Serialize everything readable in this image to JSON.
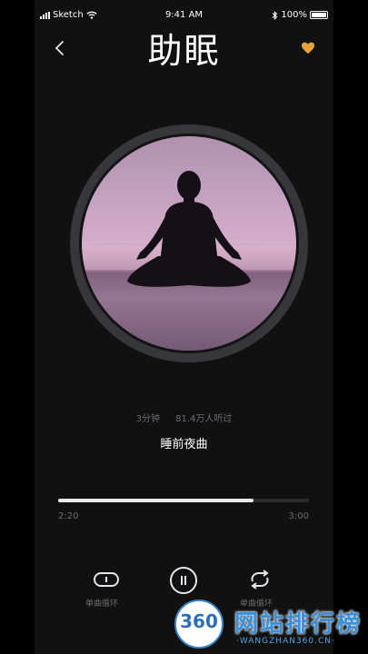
{
  "status_bar": {
    "carrier": "Sketch",
    "time": "9:41 AM",
    "battery": "100%"
  },
  "header": {
    "title": "助眠"
  },
  "track": {
    "duration_label": "3分钟",
    "listens": "81.4万人听过",
    "name": "睡前夜曲"
  },
  "player": {
    "current_time": "2:20",
    "total_time": "3:00",
    "progress": 0.78
  },
  "controls": {
    "left_label": "单曲循环",
    "right_label": "单曲循环"
  },
  "icons": {
    "back": "chevron-left-icon",
    "favorite": "heart-icon",
    "left_control": "single-loop-icon",
    "play": "pause-icon",
    "right_control": "repeat-icon"
  },
  "colors": {
    "accent_heart": "#e8a23a",
    "background": "#111112"
  },
  "watermark": {
    "badge": "360",
    "chinese": "网站排行榜",
    "english": "·WANGZHAN360.CN·"
  }
}
